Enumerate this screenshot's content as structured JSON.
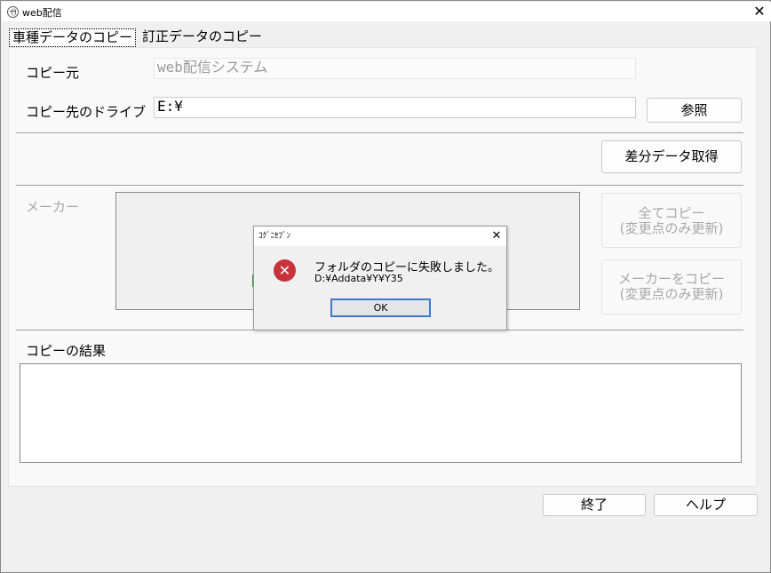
{
  "window": {
    "title": "web配信",
    "close_glyph": "✕"
  },
  "tabs": [
    {
      "label": "車種データのコピー",
      "active": true
    },
    {
      "label": "訂正データのコピー",
      "active": false
    }
  ],
  "source": {
    "label": "コピー元",
    "value": "web配信システム"
  },
  "dest": {
    "label": "コピー先のドライブ",
    "value": "E:¥",
    "browse_label": "参照"
  },
  "diff_button": "差分データ取得",
  "maker": {
    "label": "メーカー"
  },
  "copy_all": {
    "line1": "全てコピー",
    "line2": "(変更点のみ更新)"
  },
  "copy_maker": {
    "line1": "メーカーをコピー",
    "line2": "(変更点のみ更新)"
  },
  "result": {
    "label": "コピーの結果",
    "text": ""
  },
  "footer": {
    "exit_label": "終了",
    "help_label": "ヘルプ"
  },
  "dialog": {
    "title": "ｺｸﾞﾆｾﾌﾞﾝ",
    "close_glyph": "✕",
    "icon_glyph": "✕",
    "message": "フォルダのコピーに失敗しました。",
    "path": "D:¥Addata¥Y¥Y35",
    "ok_label": "OK"
  },
  "colors": {
    "error_red": "#c8323a",
    "focus_blue": "#3b7ad0",
    "green_marker": "#2e9e3e"
  }
}
